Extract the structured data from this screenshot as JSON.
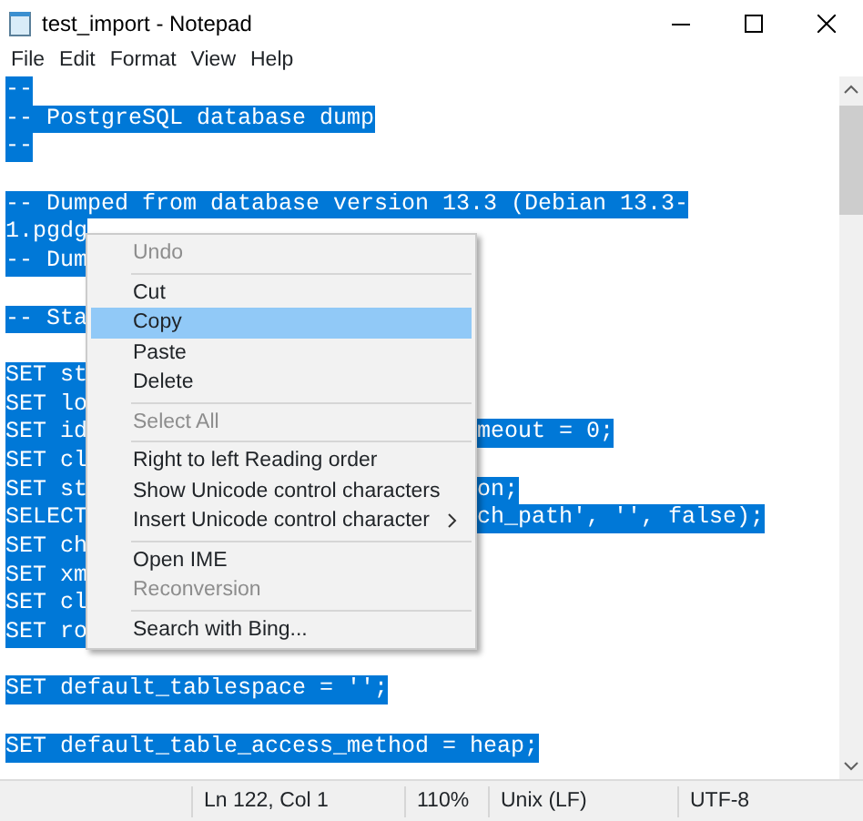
{
  "window": {
    "title": "test_import - Notepad"
  },
  "menu_bar": [
    "File",
    "Edit",
    "Format",
    "View",
    "Help"
  ],
  "editor": {
    "lines": [
      {
        "kind": "text",
        "text": "--",
        "selected": true
      },
      {
        "kind": "text",
        "text": "-- PostgreSQL database dump",
        "selected": true
      },
      {
        "kind": "text",
        "text": "--",
        "selected": true
      },
      {
        "kind": "blank"
      },
      {
        "kind": "text",
        "text": "-- Dumped from database version 13.3 (Debian 13.3-",
        "selected": true
      },
      {
        "kind": "text",
        "text": "1.pgdg",
        "selected": true
      },
      {
        "kind": "text",
        "text": "-- Dum",
        "selected": true
      },
      {
        "kind": "blank"
      },
      {
        "kind": "text",
        "text": "-- Sta",
        "selected": true
      },
      {
        "kind": "blank"
      },
      {
        "kind": "text",
        "text": "SET st",
        "selected": true
      },
      {
        "kind": "text",
        "text": "SET lo",
        "selected": true
      },
      {
        "kind": "text",
        "text": "SET id",
        "right": "meout = 0;",
        "selected": true
      },
      {
        "kind": "text",
        "text": "SET cl",
        "selected": true
      },
      {
        "kind": "text",
        "text": "SET st",
        "right": "on;",
        "selected": true
      },
      {
        "kind": "text",
        "text": "SELECT",
        "right": "ch_path', '', false);",
        "selected": true
      },
      {
        "kind": "text",
        "text": "SET ch",
        "selected": true
      },
      {
        "kind": "text",
        "text": "SET xm",
        "selected": true
      },
      {
        "kind": "text",
        "text": "SET cl",
        "selected": true
      },
      {
        "kind": "text",
        "text": "SET ro",
        "selected": true
      },
      {
        "kind": "blank"
      },
      {
        "kind": "text",
        "text": "SET default_tablespace = '';",
        "selected": true
      },
      {
        "kind": "blank"
      },
      {
        "kind": "text",
        "text": "SET default_table_access_method = heap;",
        "selected": true
      }
    ]
  },
  "context_menu": [
    {
      "kind": "item",
      "label": "Undo",
      "disabled": true,
      "selected": false
    },
    {
      "kind": "separator"
    },
    {
      "kind": "item",
      "label": "Cut",
      "disabled": false,
      "selected": false
    },
    {
      "kind": "item",
      "label": "Copy",
      "disabled": false,
      "selected": true
    },
    {
      "kind": "item",
      "label": "Paste",
      "disabled": false,
      "selected": false
    },
    {
      "kind": "item",
      "label": "Delete",
      "disabled": false,
      "selected": false
    },
    {
      "kind": "separator"
    },
    {
      "kind": "item",
      "label": "Select All",
      "disabled": true,
      "selected": false
    },
    {
      "kind": "separator"
    },
    {
      "kind": "item",
      "label": "Right to left Reading order",
      "disabled": false,
      "selected": false
    },
    {
      "kind": "item",
      "label": "Show Unicode control characters",
      "disabled": false,
      "selected": false
    },
    {
      "kind": "item",
      "label": "Insert Unicode control character",
      "disabled": false,
      "selected": false,
      "submenu": true
    },
    {
      "kind": "separator"
    },
    {
      "kind": "item",
      "label": "Open IME",
      "disabled": false,
      "selected": false
    },
    {
      "kind": "item",
      "label": "Reconversion",
      "disabled": true,
      "selected": false
    },
    {
      "kind": "separator"
    },
    {
      "kind": "item",
      "label": "Search with Bing...",
      "disabled": false,
      "selected": false
    }
  ],
  "status_bar": [
    "Ln 122, Col 1",
    "110%",
    "Unix (LF)",
    "UTF-8"
  ]
}
